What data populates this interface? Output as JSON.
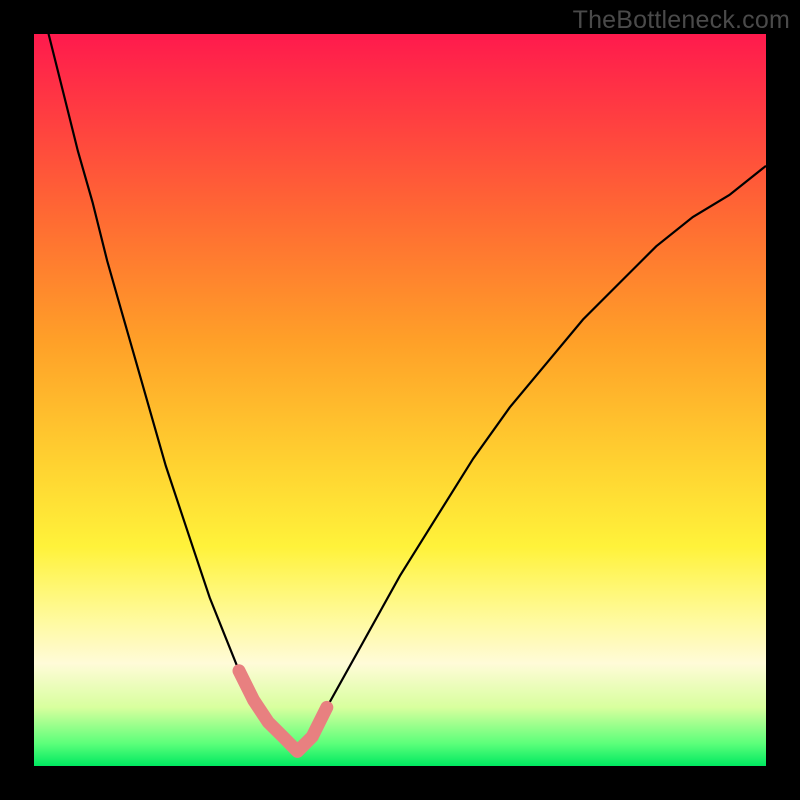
{
  "watermark": "TheBottleneck.com",
  "colors": {
    "frame_bg": "#000000",
    "gradient_stops": [
      "#ff1a4d",
      "#ff4040",
      "#ff6a33",
      "#ffa028",
      "#ffd030",
      "#fff23a",
      "#fff98a",
      "#fffbd8",
      "#d8ff9e",
      "#5aff7a",
      "#00e860"
    ],
    "curve_stroke": "#000000",
    "marker_stroke": "#e88080"
  },
  "chart_data": {
    "type": "line",
    "title": "",
    "xlabel": "",
    "ylabel": "",
    "xlim": [
      0,
      100
    ],
    "ylim": [
      0,
      100
    ],
    "x": [
      0,
      2,
      4,
      6,
      8,
      10,
      12,
      14,
      16,
      18,
      20,
      22,
      24,
      26,
      28,
      30,
      32,
      34,
      36,
      38,
      40,
      45,
      50,
      55,
      60,
      65,
      70,
      75,
      80,
      85,
      90,
      95,
      100
    ],
    "values": [
      107,
      100,
      92,
      84,
      77,
      69,
      62,
      55,
      48,
      41,
      35,
      29,
      23,
      18,
      13,
      9,
      6,
      4,
      2,
      4,
      8,
      17,
      26,
      34,
      42,
      49,
      55,
      61,
      66,
      71,
      75,
      78,
      82
    ],
    "marker_range_x": [
      28,
      40
    ],
    "legend": [],
    "grid": false,
    "annotations": []
  }
}
